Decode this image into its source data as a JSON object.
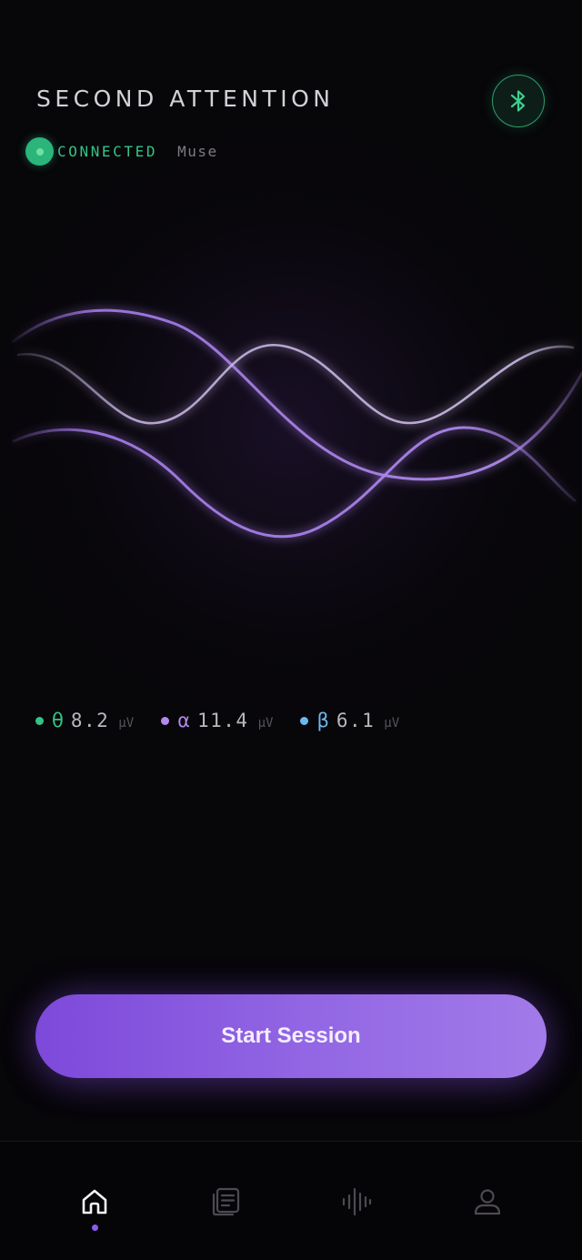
{
  "header": {
    "title": "SECOND ATTENTION",
    "status": "CONNECTED",
    "device": "Muse"
  },
  "bluetooth": {
    "icon": "bluetooth-icon"
  },
  "bands": [
    {
      "symbol": "θ",
      "value": "8.2",
      "unit": "μV",
      "color": "#34c486"
    },
    {
      "symbol": "α",
      "value": "11.4",
      "unit": "μV",
      "color": "#b489ef"
    },
    {
      "symbol": "β",
      "value": "6.1",
      "unit": "μV",
      "color": "#6ab8ee"
    }
  ],
  "cta": {
    "label": "Start Session"
  },
  "nav": {
    "items": [
      {
        "id": "home",
        "icon": "home-icon",
        "active": true
      },
      {
        "id": "journal",
        "icon": "journal-icon",
        "active": false
      },
      {
        "id": "sessions",
        "icon": "waveform-icon",
        "active": false
      },
      {
        "id": "profile",
        "icon": "profile-icon",
        "active": false
      }
    ]
  },
  "colors": {
    "accent": "#8b5cf0",
    "connected": "#34c486",
    "background": "#070609"
  }
}
